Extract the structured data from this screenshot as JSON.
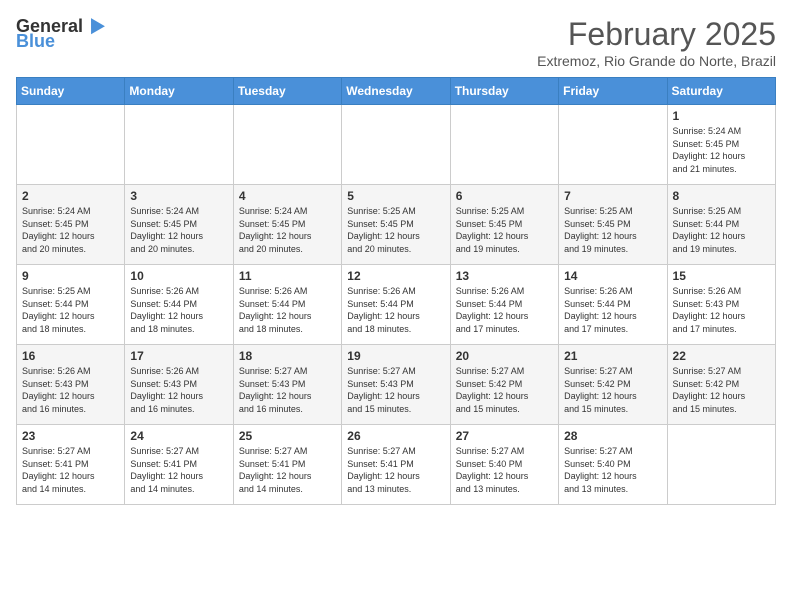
{
  "header": {
    "logo_general": "General",
    "logo_blue": "Blue",
    "month": "February 2025",
    "location": "Extremoz, Rio Grande do Norte, Brazil"
  },
  "weekdays": [
    "Sunday",
    "Monday",
    "Tuesday",
    "Wednesday",
    "Thursday",
    "Friday",
    "Saturday"
  ],
  "weeks": [
    [
      {
        "day": "",
        "info": ""
      },
      {
        "day": "",
        "info": ""
      },
      {
        "day": "",
        "info": ""
      },
      {
        "day": "",
        "info": ""
      },
      {
        "day": "",
        "info": ""
      },
      {
        "day": "",
        "info": ""
      },
      {
        "day": "1",
        "info": "Sunrise: 5:24 AM\nSunset: 5:45 PM\nDaylight: 12 hours\nand 21 minutes."
      }
    ],
    [
      {
        "day": "2",
        "info": "Sunrise: 5:24 AM\nSunset: 5:45 PM\nDaylight: 12 hours\nand 20 minutes."
      },
      {
        "day": "3",
        "info": "Sunrise: 5:24 AM\nSunset: 5:45 PM\nDaylight: 12 hours\nand 20 minutes."
      },
      {
        "day": "4",
        "info": "Sunrise: 5:24 AM\nSunset: 5:45 PM\nDaylight: 12 hours\nand 20 minutes."
      },
      {
        "day": "5",
        "info": "Sunrise: 5:25 AM\nSunset: 5:45 PM\nDaylight: 12 hours\nand 20 minutes."
      },
      {
        "day": "6",
        "info": "Sunrise: 5:25 AM\nSunset: 5:45 PM\nDaylight: 12 hours\nand 19 minutes."
      },
      {
        "day": "7",
        "info": "Sunrise: 5:25 AM\nSunset: 5:45 PM\nDaylight: 12 hours\nand 19 minutes."
      },
      {
        "day": "8",
        "info": "Sunrise: 5:25 AM\nSunset: 5:44 PM\nDaylight: 12 hours\nand 19 minutes."
      }
    ],
    [
      {
        "day": "9",
        "info": "Sunrise: 5:25 AM\nSunset: 5:44 PM\nDaylight: 12 hours\nand 18 minutes."
      },
      {
        "day": "10",
        "info": "Sunrise: 5:26 AM\nSunset: 5:44 PM\nDaylight: 12 hours\nand 18 minutes."
      },
      {
        "day": "11",
        "info": "Sunrise: 5:26 AM\nSunset: 5:44 PM\nDaylight: 12 hours\nand 18 minutes."
      },
      {
        "day": "12",
        "info": "Sunrise: 5:26 AM\nSunset: 5:44 PM\nDaylight: 12 hours\nand 18 minutes."
      },
      {
        "day": "13",
        "info": "Sunrise: 5:26 AM\nSunset: 5:44 PM\nDaylight: 12 hours\nand 17 minutes."
      },
      {
        "day": "14",
        "info": "Sunrise: 5:26 AM\nSunset: 5:44 PM\nDaylight: 12 hours\nand 17 minutes."
      },
      {
        "day": "15",
        "info": "Sunrise: 5:26 AM\nSunset: 5:43 PM\nDaylight: 12 hours\nand 17 minutes."
      }
    ],
    [
      {
        "day": "16",
        "info": "Sunrise: 5:26 AM\nSunset: 5:43 PM\nDaylight: 12 hours\nand 16 minutes."
      },
      {
        "day": "17",
        "info": "Sunrise: 5:26 AM\nSunset: 5:43 PM\nDaylight: 12 hours\nand 16 minutes."
      },
      {
        "day": "18",
        "info": "Sunrise: 5:27 AM\nSunset: 5:43 PM\nDaylight: 12 hours\nand 16 minutes."
      },
      {
        "day": "19",
        "info": "Sunrise: 5:27 AM\nSunset: 5:43 PM\nDaylight: 12 hours\nand 15 minutes."
      },
      {
        "day": "20",
        "info": "Sunrise: 5:27 AM\nSunset: 5:42 PM\nDaylight: 12 hours\nand 15 minutes."
      },
      {
        "day": "21",
        "info": "Sunrise: 5:27 AM\nSunset: 5:42 PM\nDaylight: 12 hours\nand 15 minutes."
      },
      {
        "day": "22",
        "info": "Sunrise: 5:27 AM\nSunset: 5:42 PM\nDaylight: 12 hours\nand 15 minutes."
      }
    ],
    [
      {
        "day": "23",
        "info": "Sunrise: 5:27 AM\nSunset: 5:41 PM\nDaylight: 12 hours\nand 14 minutes."
      },
      {
        "day": "24",
        "info": "Sunrise: 5:27 AM\nSunset: 5:41 PM\nDaylight: 12 hours\nand 14 minutes."
      },
      {
        "day": "25",
        "info": "Sunrise: 5:27 AM\nSunset: 5:41 PM\nDaylight: 12 hours\nand 14 minutes."
      },
      {
        "day": "26",
        "info": "Sunrise: 5:27 AM\nSunset: 5:41 PM\nDaylight: 12 hours\nand 13 minutes."
      },
      {
        "day": "27",
        "info": "Sunrise: 5:27 AM\nSunset: 5:40 PM\nDaylight: 12 hours\nand 13 minutes."
      },
      {
        "day": "28",
        "info": "Sunrise: 5:27 AM\nSunset: 5:40 PM\nDaylight: 12 hours\nand 13 minutes."
      },
      {
        "day": "",
        "info": ""
      }
    ]
  ]
}
